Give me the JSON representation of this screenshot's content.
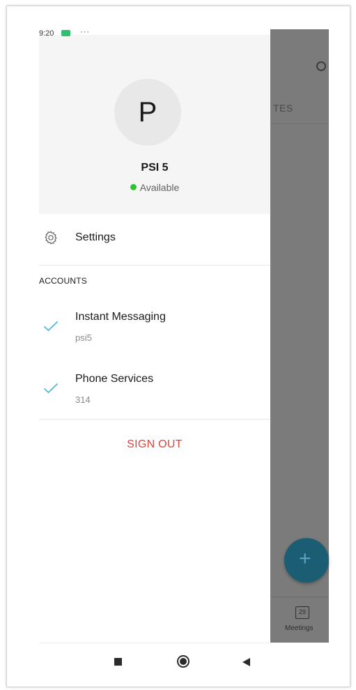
{
  "status_bar": {
    "time": "9:20",
    "more_indicator": "···"
  },
  "background_app": {
    "tab_fragment": "TES",
    "bottom_nav_label": "Meetings",
    "calendar_day": "29",
    "fab_symbol": "+"
  },
  "drawer": {
    "avatar_initial": "P",
    "user_name": "PSI 5",
    "presence": "Available",
    "presence_color": "#2ec62e",
    "settings_label": "Settings",
    "accounts_header": "ACCOUNTS",
    "accounts": [
      {
        "title": "Instant Messaging",
        "subtitle": "psi5"
      },
      {
        "title": "Phone Services",
        "subtitle": "314"
      }
    ],
    "sign_out_label": "SIGN OUT",
    "sign_out_color": "#e0433a",
    "check_color": "#4ab3d6"
  }
}
